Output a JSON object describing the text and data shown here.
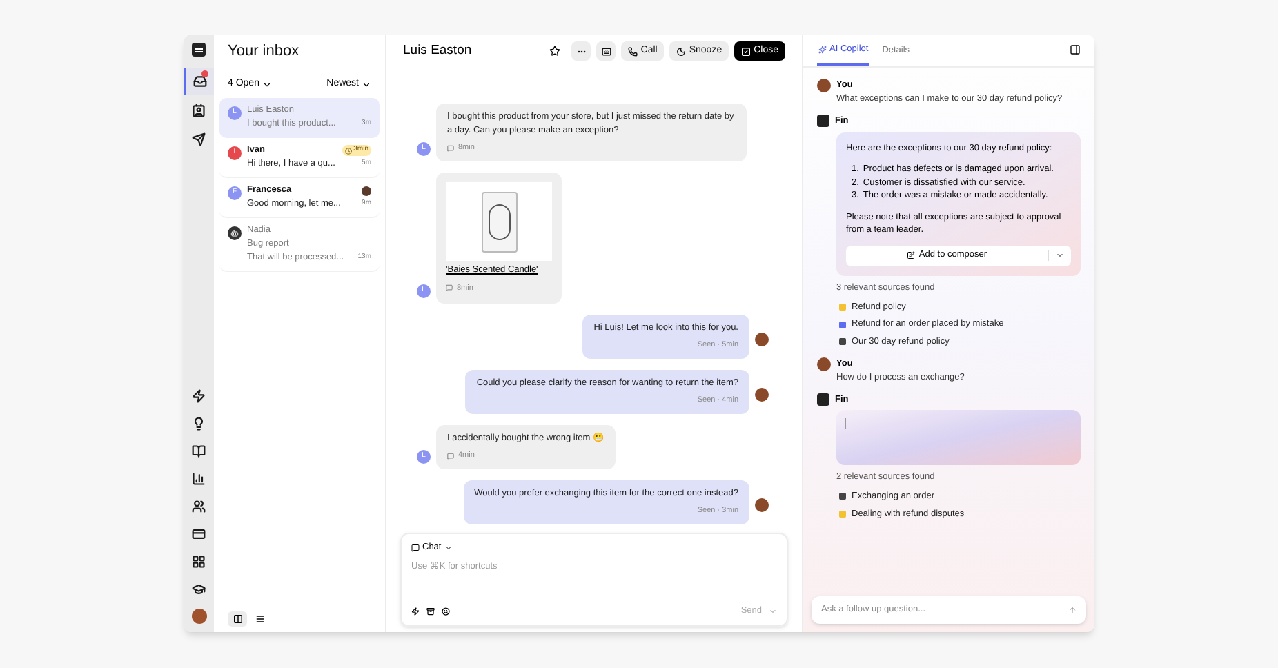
{
  "rail": {
    "top": [
      {
        "kind": "inbox",
        "selected": true,
        "badge": true
      },
      {
        "kind": "contacts",
        "selected": false,
        "badge": false
      },
      {
        "kind": "outbound",
        "selected": false,
        "badge": false
      }
    ],
    "bottom": [
      {
        "kind": "bolt"
      },
      {
        "kind": "bulb"
      },
      {
        "kind": "book"
      },
      {
        "kind": "chart"
      },
      {
        "kind": "people"
      },
      {
        "kind": "card"
      },
      {
        "kind": "apps"
      },
      {
        "kind": "school"
      }
    ]
  },
  "inbox": {
    "title": "Your inbox",
    "filter": "4 Open",
    "sort": "Newest",
    "conversations": [
      {
        "name": "Luis Easton",
        "preview": "I bought this product...",
        "time": "3m",
        "avatar": "L",
        "color": "#8b93f3",
        "kind": "letter",
        "selected": true,
        "unread": false,
        "assignee": false
      },
      {
        "name": "Ivan",
        "preview": "Hi there, I have a qu...",
        "time": "5m",
        "avatar": "I",
        "color": "#e5484d",
        "kind": "letter",
        "selected": false,
        "unread": true,
        "badge": "3min",
        "assignee": false
      },
      {
        "name": "Francesca",
        "preview": "Good morning, let me...",
        "time": "9m",
        "avatar": "F",
        "color": "#8b93f3",
        "kind": "letter",
        "selected": false,
        "unread": true,
        "assignee": true
      },
      {
        "name": "Nadia",
        "subject": "Bug report",
        "preview": "That will be processed...",
        "time": "13m",
        "kind": "icon",
        "selected": false,
        "unread": false,
        "assignee": false
      }
    ],
    "views": [
      {
        "kind": "split",
        "selected": true
      },
      {
        "kind": "list",
        "selected": false
      }
    ]
  },
  "conversation": {
    "title": "Luis Easton",
    "actions": [
      {
        "kind": "more"
      },
      {
        "kind": "shortcut"
      },
      {
        "kind": "call",
        "label": "Call"
      },
      {
        "kind": "snooze",
        "label": "Snooze"
      },
      {
        "kind": "close",
        "label": "Close"
      }
    ],
    "messages": [
      {
        "kind": "customer",
        "avatar": "L",
        "text": "I bought this product from your store, but I just missed the return date by a day. Can you please make an exception?",
        "meta": "8min"
      },
      {
        "kind": "product",
        "avatar": "L",
        "text": "'Baies Scented Candle'",
        "meta": "8min"
      },
      {
        "kind": "agent",
        "text": "Hi Luis! Let me look into this for you.",
        "meta": "Seen · 5min"
      },
      {
        "kind": "agent",
        "text": "Could you please clarify the reason for wanting to return the item?",
        "meta": "Seen · 4min"
      },
      {
        "kind": "customer",
        "avatar": "L",
        "text": "I accidentally bought the wrong item 😬",
        "meta": "4min"
      },
      {
        "kind": "agent",
        "text": "Would you prefer exchanging this item for the correct one instead?",
        "meta": "Seen · 3min"
      }
    ],
    "composer": {
      "channel": "Chat",
      "placeholder": "Use ⌘K for shortcuts",
      "send": "Send"
    }
  },
  "copilot": {
    "tabs": [
      {
        "label": "AI Copilot",
        "selected": true
      },
      {
        "label": "Details",
        "selected": false
      }
    ],
    "thread": [
      {
        "kind": "you",
        "author": "You",
        "text": "What exceptions can I make to our 30 day refund policy?"
      },
      {
        "kind": "fin",
        "author": "Fin",
        "intro": "Here are the exceptions to our 30 day refund policy:",
        "points": [
          {
            "number": "1.",
            "text": "Product has defects or is damaged upon arrival."
          },
          {
            "number": "2.",
            "text": "Customer is dissatisfied with our service."
          },
          {
            "number": "3.",
            "text": "The order was a mistake or made accidentally."
          }
        ],
        "note": "Please note that all exceptions are subject to approval from a team leader.",
        "action": "Add to composer",
        "typing": false,
        "sources_title": "3 relevant sources found",
        "sources": [
          {
            "title": "Refund policy",
            "color": "#f2c230"
          },
          {
            "title": "Refund for an order placed by mistake",
            "color": "#5b6cf0"
          },
          {
            "title": "Our 30 day refund policy",
            "color": "#444444"
          }
        ]
      },
      {
        "kind": "you",
        "author": "You",
        "text": "How do I process an exchange?"
      },
      {
        "kind": "fin",
        "author": "Fin",
        "typing": true,
        "sources_title": "2 relevant sources found",
        "sources": [
          {
            "title": "Exchanging an order",
            "color": "#444444"
          },
          {
            "title": "Dealing with refund disputes",
            "color": "#f2c230"
          }
        ]
      }
    ],
    "input_placeholder": "Ask a follow up question..."
  }
}
